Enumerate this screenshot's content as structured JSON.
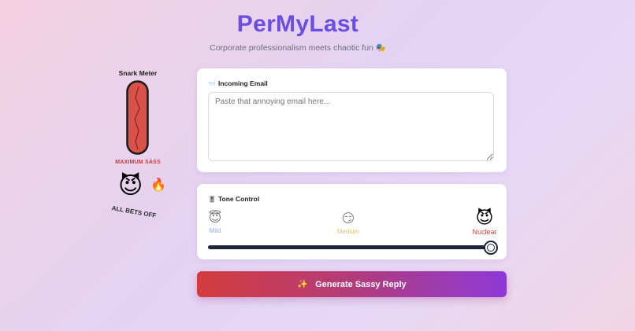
{
  "header": {
    "title": "PerMyLast",
    "subtitle": "Corporate professionalism meets chaotic fun 🎭"
  },
  "meter": {
    "title": "Snark Meter",
    "level": 1.0,
    "status": "MAXIMUM SASS",
    "emoji": "😈",
    "fire": "🔥",
    "caption": "ALL BETS OFF",
    "fill_color": "#d9524a",
    "crack_color": "#7a1a1a"
  },
  "email": {
    "icon": "📨",
    "label": "Incoming Email",
    "placeholder": "Paste that annoying email here...",
    "value": ""
  },
  "tone": {
    "icon": "🎚️",
    "label": "Tone Control",
    "options": [
      {
        "emoji": "😇",
        "label": "Mild"
      },
      {
        "emoji": "😏",
        "label": "Medium"
      },
      {
        "emoji": "😈",
        "label": "Nuclear"
      }
    ],
    "selected": "Nuclear",
    "value": 1.0
  },
  "generate": {
    "icon": "✨",
    "label": "Generate Sassy Reply"
  },
  "colors": {
    "accent": "#6a4ee2",
    "button_start": "#d53d3e",
    "button_end": "#8d39d8",
    "danger": "#d64545"
  }
}
